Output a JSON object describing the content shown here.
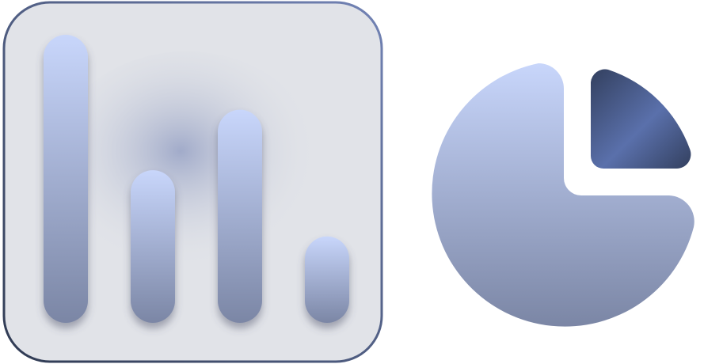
{
  "icons": {
    "bar_chart": {
      "name": "bar-chart-icon",
      "bar_levels": [
        1.0,
        0.53,
        0.74,
        0.3
      ],
      "colors": {
        "tile_background": "#e1e3e8",
        "tile_border_start": "#2f3a52",
        "tile_border_end": "#7283b5",
        "bar_top": "#c8d6fb",
        "bar_bottom": "#7b86a5",
        "glow": "#9ea8c8"
      }
    },
    "pie_chart": {
      "name": "pie-chart-icon",
      "slice_fraction": 0.25,
      "colors": {
        "main_top": "#c8d6fb",
        "main_bottom": "#7b86a5",
        "slice_dark": "#33405f",
        "slice_mid": "#5a70ab"
      }
    }
  }
}
